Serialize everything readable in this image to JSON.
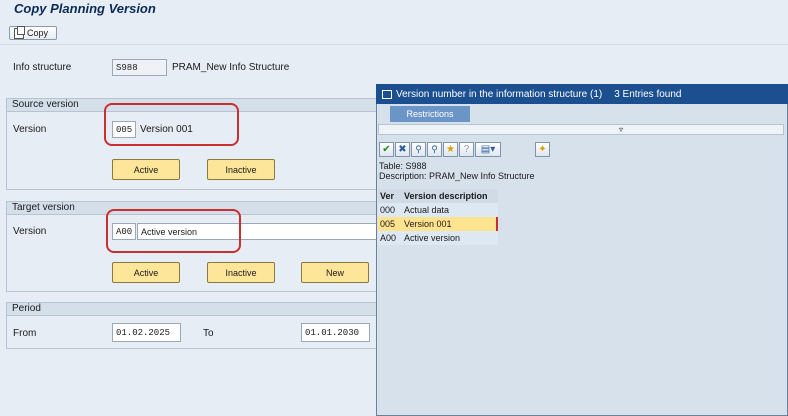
{
  "window": {
    "title": "Copy Planning Version"
  },
  "toolbar": {
    "copy_label": "Copy"
  },
  "info_structure": {
    "label": "Info structure",
    "code": "S988",
    "name": "PRAM_New Info Structure"
  },
  "source": {
    "group_label": "Source version",
    "version_label": "Version",
    "version_value": "005",
    "version_desc": "Version 001",
    "active_btn": "Active",
    "inactive_btn": "Inactive"
  },
  "target": {
    "group_label": "Target version",
    "version_label": "Version",
    "version_value": "A00",
    "version_desc": "Active version",
    "active_btn": "Active",
    "inactive_btn": "Inactive",
    "new_btn": "New"
  },
  "period": {
    "group_label": "Period",
    "from_label": "From",
    "from_value": "01.02.2025",
    "to_label": "To",
    "to_value": "01.01.2030"
  },
  "popup": {
    "title": "Version number in the information structure (1)",
    "entries_found": "3 Entries found",
    "tab_label": "Restrictions",
    "table_line": "Table: S988",
    "description_line": "Description: PRAM_New Info Structure",
    "columns": [
      "Ver",
      "Version description"
    ],
    "rows": [
      {
        "ver": "000",
        "desc": "Actual data"
      },
      {
        "ver": "005",
        "desc": "Version 001"
      },
      {
        "ver": "A00",
        "desc": "Active version"
      }
    ]
  }
}
